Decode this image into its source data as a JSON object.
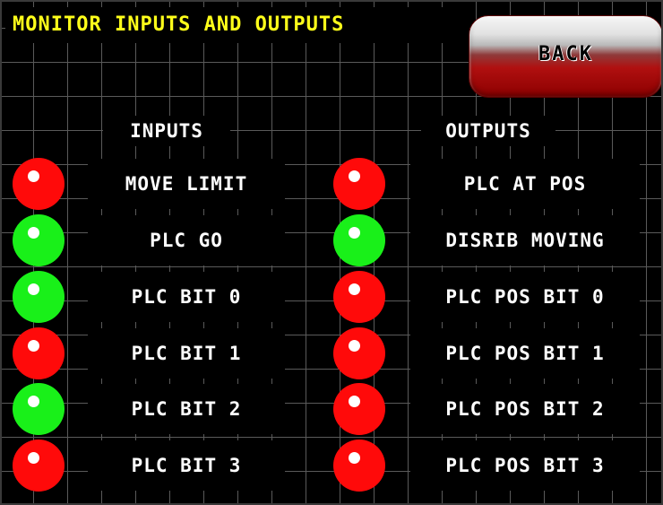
{
  "header": {
    "title": "MONITOR INPUTS AND OUTPUTS",
    "back_label": "BACK"
  },
  "columns": {
    "inputs_label": "INPUTS",
    "outputs_label": "OUTPUTS"
  },
  "colors": {
    "title": "#ffff1a",
    "on": "#19f019",
    "off": "#ff0a0a",
    "back_button": "#b01010"
  },
  "inputs": [
    {
      "label": "MOVE LIMIT",
      "state": "off"
    },
    {
      "label": "PLC GO",
      "state": "on"
    },
    {
      "label": "PLC BIT 0",
      "state": "on"
    },
    {
      "label": "PLC BIT 1",
      "state": "off"
    },
    {
      "label": "PLC BIT 2",
      "state": "on"
    },
    {
      "label": "PLC BIT 3",
      "state": "off"
    }
  ],
  "outputs": [
    {
      "label": "PLC AT POS",
      "state": "off"
    },
    {
      "label": "DISRIB MOVING",
      "state": "on"
    },
    {
      "label": "PLC POS BIT 0",
      "state": "off"
    },
    {
      "label": "PLC POS BIT 1",
      "state": "off"
    },
    {
      "label": "PLC POS BIT 2",
      "state": "off"
    },
    {
      "label": "PLC POS BIT 3",
      "state": "off"
    }
  ]
}
